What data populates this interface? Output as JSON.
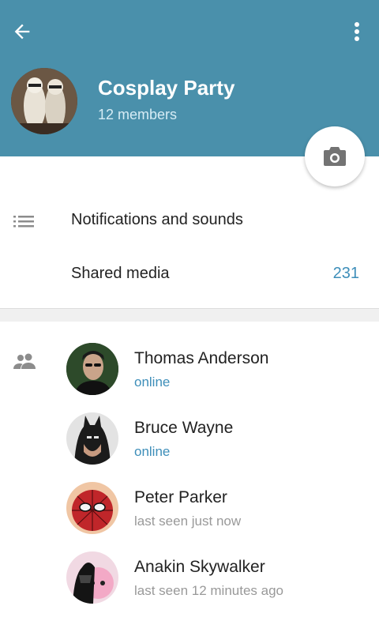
{
  "header": {
    "title": "Cosplay Party",
    "subtitle": "12 members",
    "background": "#4a90ab",
    "back_icon": "arrow-left-icon",
    "menu_icon": "more-vertical-icon",
    "camera_icon": "camera-icon"
  },
  "settings": {
    "notifications_label": "Notifications and sounds",
    "notifications_icon": "list-icon",
    "shared_media_label": "Shared media",
    "shared_media_count": "231"
  },
  "members_icon": "people-icon",
  "members": [
    {
      "name": "Thomas Anderson",
      "status": "online",
      "online": true
    },
    {
      "name": "Bruce Wayne",
      "status": "online",
      "online": true
    },
    {
      "name": "Peter Parker",
      "status": "last seen just now",
      "online": false
    },
    {
      "name": "Anakin Skywalker",
      "status": "last seen 12 minutes ago",
      "online": false
    }
  ],
  "colors": {
    "accent": "#3d8eb9",
    "status_gray": "#999999"
  }
}
